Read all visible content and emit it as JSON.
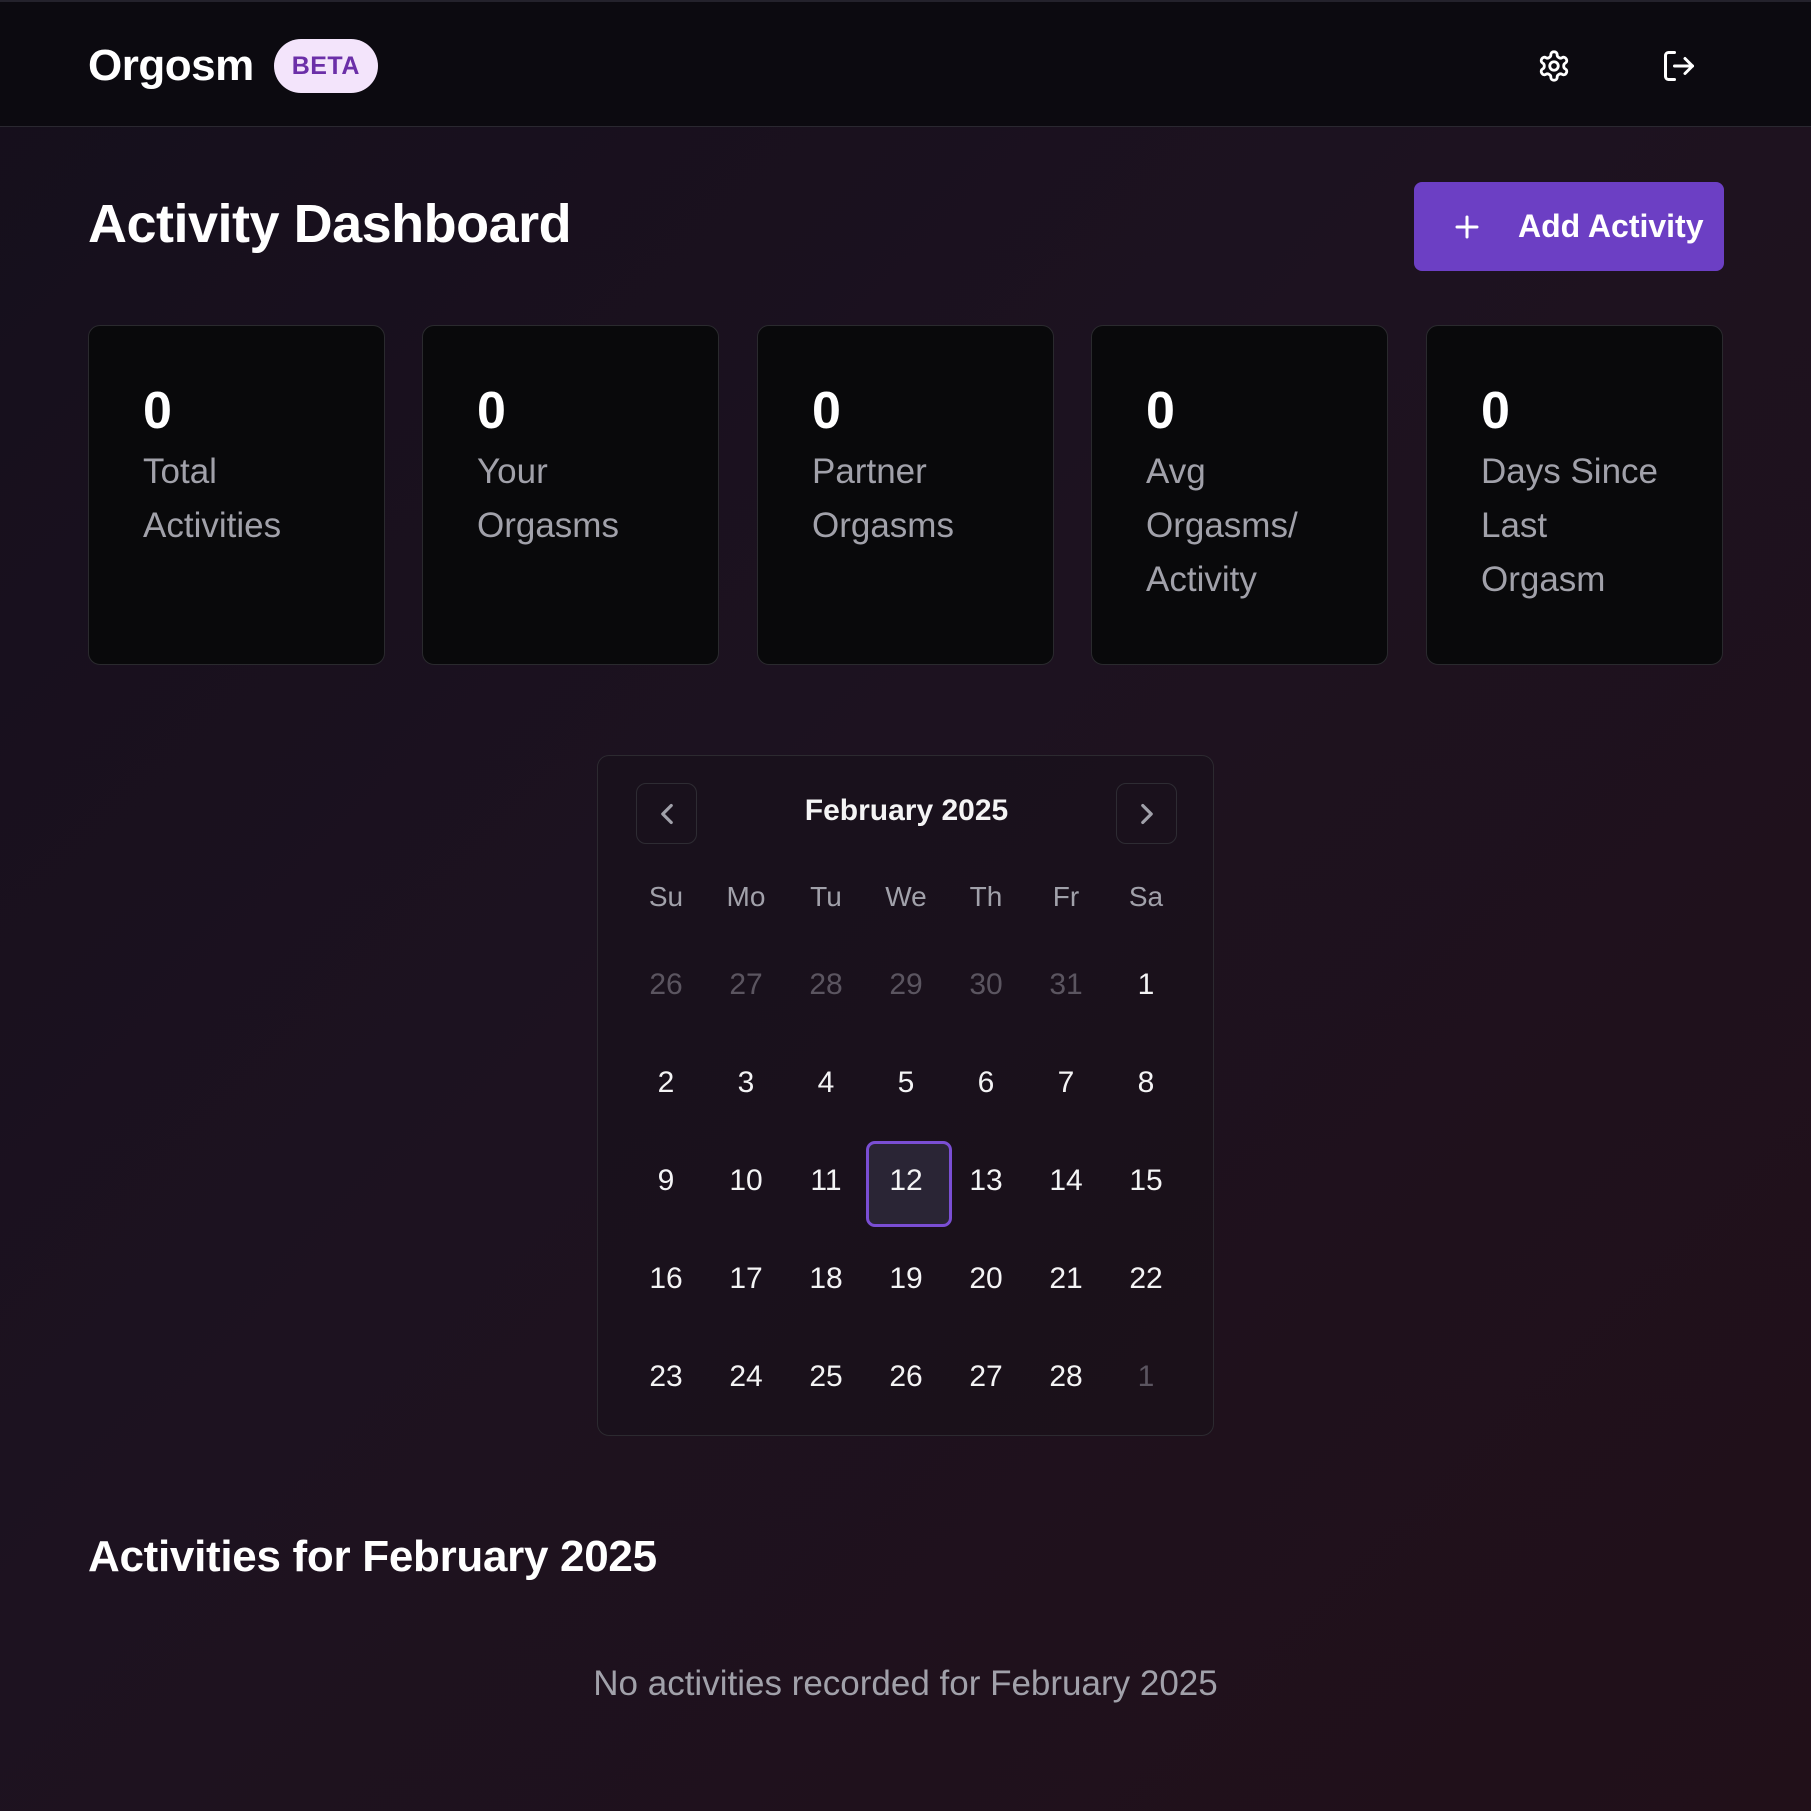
{
  "header": {
    "brand": "Orgosm",
    "badge": "BETA",
    "settings_icon": "gear-icon",
    "logout_icon": "logout-icon"
  },
  "main": {
    "title": "Activity Dashboard",
    "add_button_label": "Add Activity",
    "stats": [
      {
        "value": "0",
        "label": "Total Activities"
      },
      {
        "value": "0",
        "label": "Your Orgasms"
      },
      {
        "value": "0",
        "label": "Partner Orgasms"
      },
      {
        "value": "0",
        "label": "Avg Orgasms/ Activity"
      },
      {
        "value": "0",
        "label": "Days Since Last Orgasm"
      }
    ]
  },
  "calendar": {
    "month_label": "February 2025",
    "weekdays": [
      "Su",
      "Mo",
      "Tu",
      "We",
      "Th",
      "Fr",
      "Sa"
    ],
    "days": [
      {
        "label": "26",
        "outside": true
      },
      {
        "label": "27",
        "outside": true
      },
      {
        "label": "28",
        "outside": true
      },
      {
        "label": "29",
        "outside": true
      },
      {
        "label": "30",
        "outside": true
      },
      {
        "label": "31",
        "outside": true
      },
      {
        "label": "1"
      },
      {
        "label": "2"
      },
      {
        "label": "3"
      },
      {
        "label": "4"
      },
      {
        "label": "5"
      },
      {
        "label": "6"
      },
      {
        "label": "7"
      },
      {
        "label": "8"
      },
      {
        "label": "9"
      },
      {
        "label": "10"
      },
      {
        "label": "11"
      },
      {
        "label": "12",
        "selected": true
      },
      {
        "label": "13"
      },
      {
        "label": "14"
      },
      {
        "label": "15"
      },
      {
        "label": "16"
      },
      {
        "label": "17"
      },
      {
        "label": "18"
      },
      {
        "label": "19"
      },
      {
        "label": "20"
      },
      {
        "label": "21"
      },
      {
        "label": "22"
      },
      {
        "label": "23"
      },
      {
        "label": "24"
      },
      {
        "label": "25"
      },
      {
        "label": "26"
      },
      {
        "label": "27"
      },
      {
        "label": "28"
      },
      {
        "label": "1",
        "outside": true
      }
    ],
    "accent_color": "#7a4ed4"
  },
  "activities": {
    "title": "Activities for February 2025",
    "empty_message": "No activities recorded for February 2025"
  },
  "colors": {
    "primary": "#6c3fc4",
    "badge_bg": "#f3e4fb",
    "badge_text": "#6b2fa8"
  }
}
